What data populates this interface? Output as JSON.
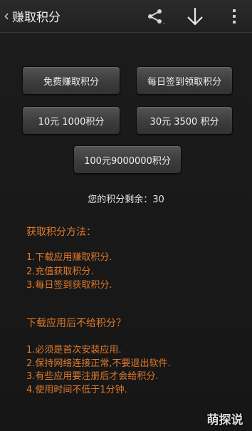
{
  "header": {
    "title": "赚取积分",
    "back_glyph": "‹",
    "icons": [
      "share-icon",
      "download-icon",
      "overflow-menu-icon"
    ]
  },
  "buttons": {
    "free_earn": "免费赚取积分",
    "daily_checkin": "每日签到领取积分",
    "pack_10": "10元 1000积分",
    "pack_30": "30元 3500 积分",
    "pack_100": "100元9000000积分"
  },
  "balance": {
    "label": "您的积分剩余：",
    "value": "30"
  },
  "methods": {
    "title": "获取积分方法：",
    "items": [
      "1.下载应用赚取积分.",
      "2.充值获取积分.",
      "3.每日签到获取积分."
    ]
  },
  "faq": {
    "title": "下载应用后不给积分？",
    "items": [
      "1.必须是首次安装应用.",
      "2.保持网络连接正常,不要退出软件.",
      "3.有些应用要注册后才会给积分.",
      "4.使用时间不低于1分钟."
    ]
  },
  "colors": {
    "accent_orange": "#e07a2c",
    "background": "#181818"
  },
  "watermark": "萌探说"
}
